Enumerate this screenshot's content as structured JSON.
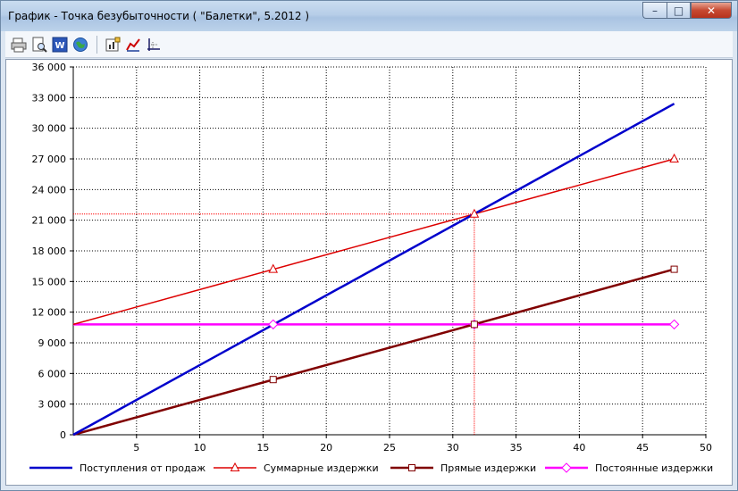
{
  "window": {
    "title": "График - Точка безубыточности ( \"Балетки\", 5.2012 )",
    "min_glyph": "–",
    "max_glyph": "□",
    "close_glyph": "✕"
  },
  "toolbar": {
    "items": [
      {
        "icon": "print-icon"
      },
      {
        "icon": "print-preview-icon"
      },
      {
        "icon": "word-export-icon"
      },
      {
        "icon": "web-export-icon"
      },
      {
        "icon": "chart-properties-icon"
      },
      {
        "icon": "chart-type-icon"
      },
      {
        "icon": "axes-icon"
      }
    ]
  },
  "chart_data": {
    "type": "line",
    "xlim": [
      0,
      50
    ],
    "ylim": [
      0,
      36000
    ],
    "x_ticks": [
      5,
      10,
      15,
      20,
      25,
      30,
      35,
      40,
      45,
      50
    ],
    "y_ticks": [
      0,
      3000,
      6000,
      9000,
      12000,
      15000,
      18000,
      21000,
      24000,
      27000,
      30000,
      33000,
      36000
    ],
    "y_tick_labels": [
      "0",
      "3 000",
      "6 000",
      "9 000",
      "12 000",
      "15 000",
      "18 000",
      "21 000",
      "24 000",
      "27 000",
      "30 000",
      "33 000",
      "36 000"
    ],
    "x_tick_labels": [
      "5",
      "10",
      "15",
      "20",
      "25",
      "30",
      "35",
      "40",
      "45",
      "50"
    ],
    "grid": true,
    "legend_position": "bottom",
    "breakeven": {
      "x": 31.7,
      "y": 21600,
      "color": "#ff0000"
    },
    "series": [
      {
        "name": "Поступления от продаж",
        "color": "#0000cc",
        "marker": "none",
        "points": [
          [
            0,
            0
          ],
          [
            47.5,
            32400
          ]
        ],
        "marker_points": []
      },
      {
        "name": "Суммарные издержки",
        "color": "#dd0000",
        "marker": "triangle",
        "points": [
          [
            0,
            10800
          ],
          [
            47.5,
            27000
          ]
        ],
        "marker_points": [
          [
            15.8,
            16200
          ],
          [
            31.7,
            21600
          ],
          [
            47.5,
            27000
          ]
        ]
      },
      {
        "name": "Прямые издержки",
        "color": "#800000",
        "marker": "square",
        "points": [
          [
            0,
            0
          ],
          [
            47.5,
            16200
          ]
        ],
        "marker_points": [
          [
            15.8,
            5400
          ],
          [
            31.7,
            10800
          ],
          [
            47.5,
            16200
          ]
        ]
      },
      {
        "name": "Постоянные издержки",
        "color": "#ff00ff",
        "marker": "diamond",
        "points": [
          [
            0,
            10800
          ],
          [
            47.5,
            10800
          ]
        ],
        "marker_points": [
          [
            15.8,
            10800
          ],
          [
            31.7,
            10800
          ],
          [
            47.5,
            10800
          ]
        ]
      }
    ]
  }
}
